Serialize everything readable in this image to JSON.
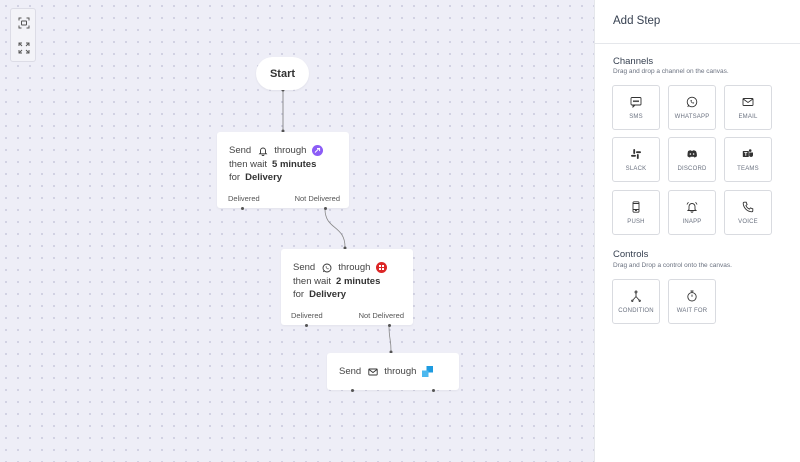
{
  "canvas": {
    "start_label": "Start",
    "nodes": [
      {
        "send_label": "Send",
        "channel_icon": "bell-icon",
        "through_label": "through",
        "provider_icon": "provider-purple-icon",
        "wait_label": "then wait",
        "wait_value": "5 minutes",
        "for_label": "for",
        "for_value": "Delivery",
        "delivered_label": "Delivered",
        "not_delivered_label": "Not Delivered"
      },
      {
        "send_label": "Send",
        "channel_icon": "whatsapp-icon",
        "through_label": "through",
        "provider_icon": "provider-red-icon",
        "wait_label": "then wait",
        "wait_value": "2 minutes",
        "for_label": "for",
        "for_value": "Delivery",
        "delivered_label": "Delivered",
        "not_delivered_label": "Not Delivered"
      },
      {
        "send_label": "Send",
        "channel_icon": "email-icon",
        "through_label": "through",
        "provider_icon": "provider-blue-icon"
      }
    ]
  },
  "panel": {
    "title": "Add Step",
    "channels": {
      "title": "Channels",
      "subtitle": "Drag and drop a channel on the canvas.",
      "items": [
        {
          "label": "SMS",
          "icon": "sms-icon"
        },
        {
          "label": "WHATSAPP",
          "icon": "whatsapp-icon"
        },
        {
          "label": "EMAIL",
          "icon": "email-icon"
        },
        {
          "label": "SLACK",
          "icon": "slack-icon"
        },
        {
          "label": "DISCORD",
          "icon": "discord-icon"
        },
        {
          "label": "TEAMS",
          "icon": "teams-icon"
        },
        {
          "label": "PUSH",
          "icon": "push-icon"
        },
        {
          "label": "INAPP",
          "icon": "inapp-icon"
        },
        {
          "label": "VOICE",
          "icon": "voice-icon"
        }
      ]
    },
    "controls": {
      "title": "Controls",
      "subtitle": "Drag and Drop a control onto the canvas.",
      "items": [
        {
          "label": "CONDITION",
          "icon": "condition-icon"
        },
        {
          "label": "WAIT FOR",
          "icon": "timer-icon"
        }
      ]
    }
  },
  "colors": {
    "canvas_bg": "#eeeef7",
    "provider_purple": "#8b5cf6",
    "provider_red": "#dc2626",
    "provider_blue": "#1e9be0"
  }
}
